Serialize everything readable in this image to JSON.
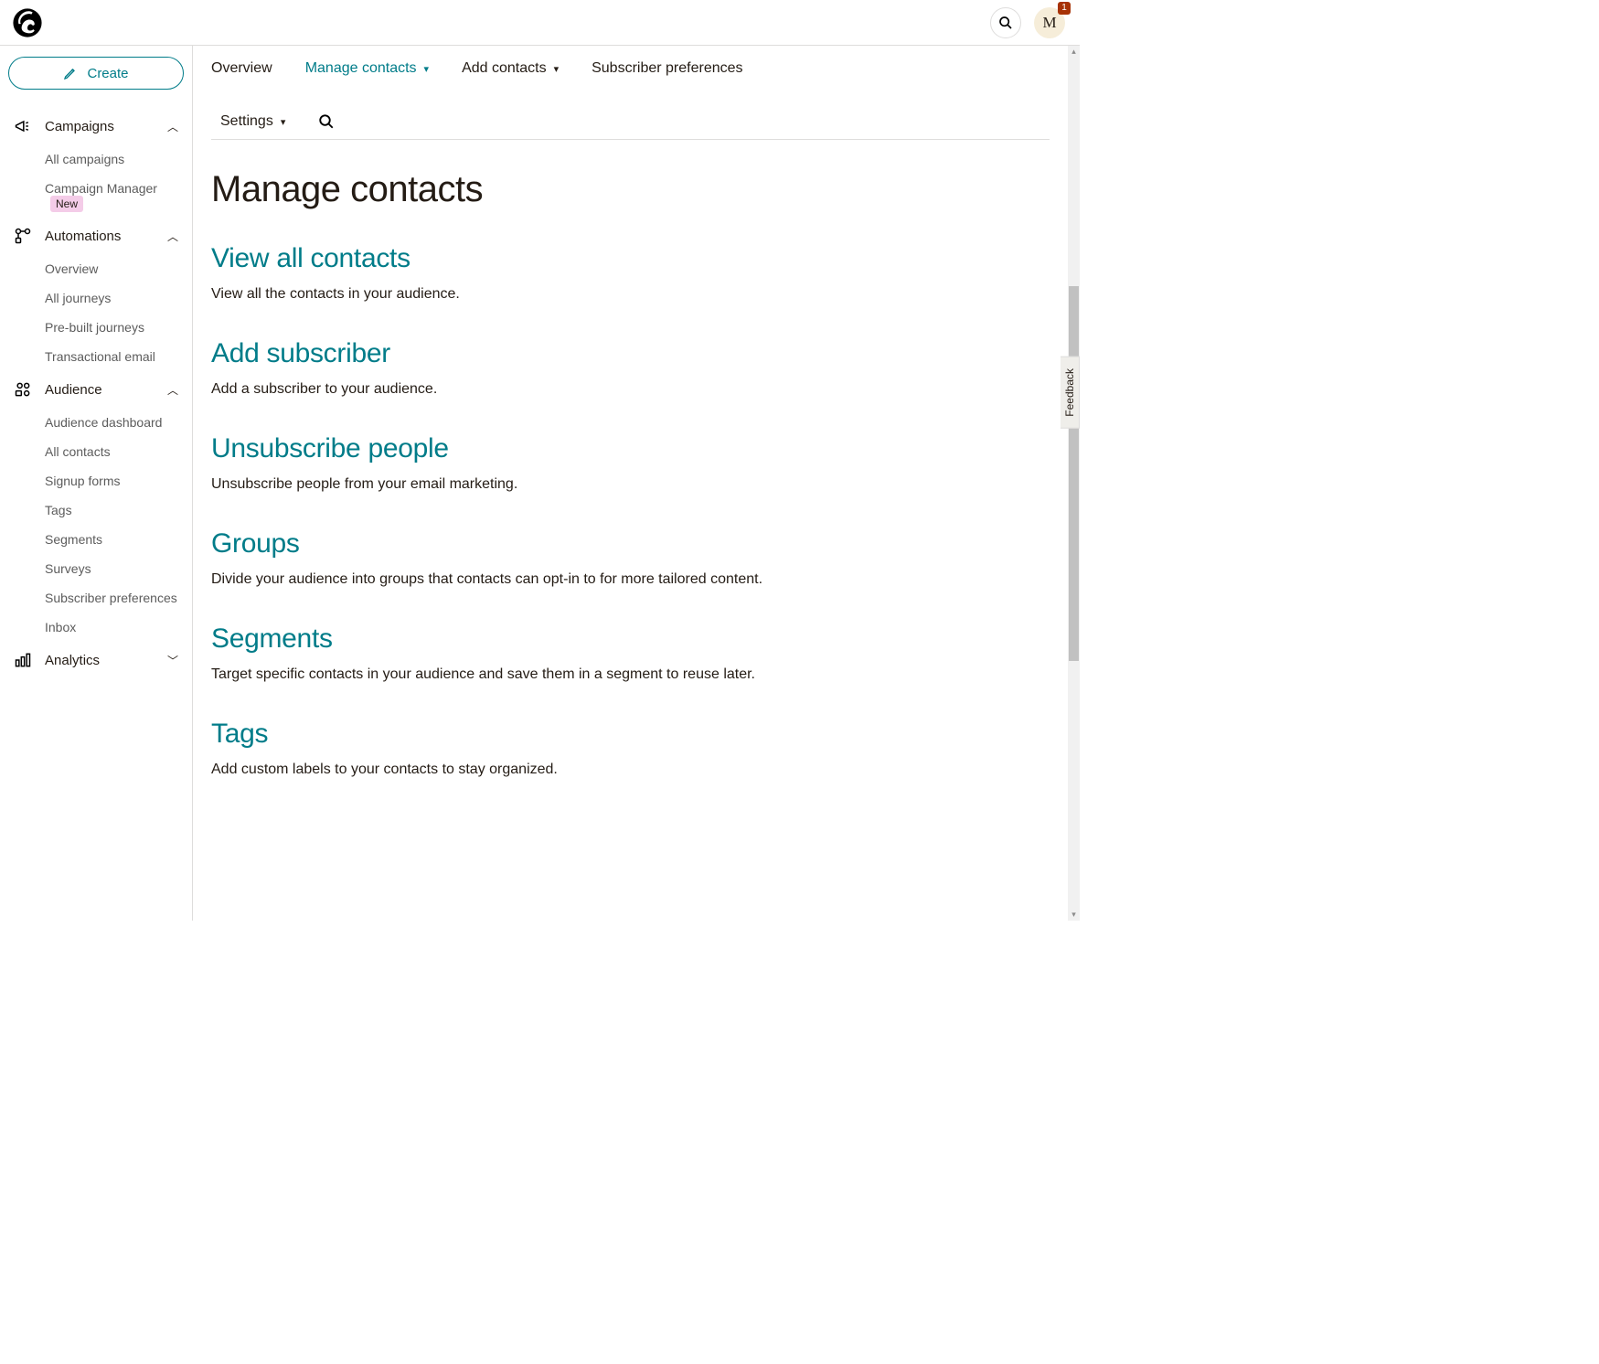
{
  "header": {
    "avatar_initial": "M",
    "notification_count": "1"
  },
  "sidebar": {
    "create_label": "Create",
    "sections": {
      "campaigns": {
        "label": "Campaigns",
        "items": {
          "all": "All campaigns",
          "manager": "Campaign Manager",
          "manager_badge": "New"
        }
      },
      "automations": {
        "label": "Automations",
        "items": {
          "overview": "Overview",
          "all_journeys": "All journeys",
          "prebuilt": "Pre-built journeys",
          "transactional": "Transactional email"
        }
      },
      "audience": {
        "label": "Audience",
        "items": {
          "dashboard": "Audience dashboard",
          "all_contacts": "All contacts",
          "signup": "Signup forms",
          "tags": "Tags",
          "segments": "Segments",
          "surveys": "Surveys",
          "subprefs": "Subscriber preferences",
          "inbox": "Inbox"
        }
      },
      "analytics": {
        "label": "Analytics"
      }
    }
  },
  "tabs": {
    "overview": "Overview",
    "manage_contacts": "Manage contacts",
    "add_contacts": "Add contacts",
    "subscriber_prefs": "Subscriber preferences",
    "settings": "Settings"
  },
  "page": {
    "title": "Manage contacts",
    "sections": {
      "view_all": {
        "title": "View all contacts",
        "desc": "View all the contacts in your audience."
      },
      "add_sub": {
        "title": "Add subscriber",
        "desc": "Add a subscriber to your audience."
      },
      "unsub": {
        "title": "Unsubscribe people",
        "desc": "Unsubscribe people from your email marketing."
      },
      "groups": {
        "title": "Groups",
        "desc": "Divide your audience into groups that contacts can opt-in to for more tailored content."
      },
      "segments": {
        "title": "Segments",
        "desc": "Target specific contacts in your audience and save them in a segment to reuse later."
      },
      "tags": {
        "title": "Tags",
        "desc": "Add custom labels to your contacts to stay organized."
      }
    }
  },
  "feedback_label": "Feedback"
}
